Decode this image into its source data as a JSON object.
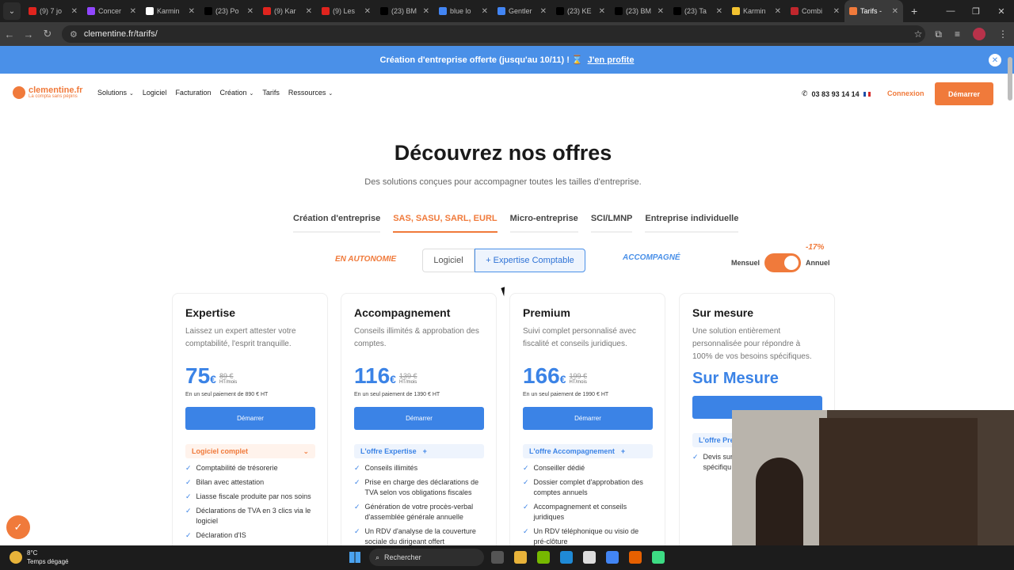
{
  "browser": {
    "tabs": [
      {
        "title": "(9) 7 jo",
        "color": "#e0241e"
      },
      {
        "title": "Concer",
        "color": "#9146ff"
      },
      {
        "title": "Karmin",
        "color": "#ffffff"
      },
      {
        "title": "(23) Po",
        "color": "#000000"
      },
      {
        "title": "(9) Kar",
        "color": "#e0241e"
      },
      {
        "title": "(9) Les",
        "color": "#e0241e"
      },
      {
        "title": "(23) BM",
        "color": "#000000"
      },
      {
        "title": "blue lo",
        "color": "#4285f4"
      },
      {
        "title": "Gentler",
        "color": "#4285f4"
      },
      {
        "title": "(23) KE",
        "color": "#000000"
      },
      {
        "title": "(23) BM",
        "color": "#000000"
      },
      {
        "title": "(23) Ta",
        "color": "#000000"
      },
      {
        "title": "Karmin",
        "color": "#f2c230"
      },
      {
        "title": "Combi",
        "color": "#c0272d"
      },
      {
        "title": "Tarifs -",
        "color": "#f07a3b"
      }
    ],
    "url": "clementine.fr/tarifs/"
  },
  "banner": {
    "text": "Création d'entreprise offerte (jusqu'au 10/11) ! ⌛",
    "link": "J'en profite"
  },
  "nav": {
    "logo": "clementine.fr",
    "logo_tagline": "La compta sans pépins",
    "items": [
      {
        "label": "Solutions",
        "caret": true
      },
      {
        "label": "Logiciel",
        "caret": false
      },
      {
        "label": "Facturation",
        "caret": false
      },
      {
        "label": "Création",
        "caret": true
      },
      {
        "label": "Tarifs",
        "caret": false
      },
      {
        "label": "Ressources",
        "caret": true
      }
    ],
    "phone": "03 83 93 14 14",
    "login": "Connexion",
    "cta": "Démarrer"
  },
  "hero": {
    "title": "Découvrez nos offres",
    "subtitle": "Des solutions conçues pour accompagner toutes les tailles d'entreprise."
  },
  "category_tabs": [
    {
      "label": "Création d'entreprise",
      "active": false
    },
    {
      "label": "SAS, SASU, SARL, EURL",
      "active": true
    },
    {
      "label": "Micro-entreprise",
      "active": false
    },
    {
      "label": "SCI/LMNP",
      "active": false
    },
    {
      "label": "Entreprise individuelle",
      "active": false
    }
  ],
  "mode_toggle": {
    "left_hint": "EN AUTONOMIE",
    "option_a": "Logiciel",
    "option_b": "+ Expertise Comptable",
    "right_hint": "ACCOMPAGNÉ"
  },
  "billing": {
    "monthly": "Mensuel",
    "yearly": "Annuel",
    "discount": "-17%"
  },
  "plans": [
    {
      "name": "Expertise",
      "desc": "Laissez un expert attester votre comptabilité, l'esprit tranquille.",
      "price": "75",
      "currency": "€",
      "old_price": "89 €",
      "unit": "HT/mois",
      "oneshot": "En un seul paiement de 890 € HT",
      "button": "Démarrer",
      "pill": "Logiciel complet",
      "pill_suffix": "⌄",
      "features": [
        "Comptabilité de trésorerie",
        "Bilan avec attestation",
        "Liasse fiscale produite par nos soins",
        "Déclarations de TVA en 3 clics via le logiciel",
        "Déclaration d'IS"
      ]
    },
    {
      "name": "Accompagnement",
      "desc": "Conseils illimités & approbation des comptes.",
      "price": "116",
      "currency": "€",
      "old_price": "139 €",
      "unit": "HT/mois",
      "oneshot": "En un seul paiement de 1390 € HT",
      "button": "Démarrer",
      "pill": "L'offre Expertise",
      "pill_suffix": "+",
      "features": [
        "Conseils illimités",
        "Prise en charge des déclarations de TVA selon vos obligations fiscales",
        "Génération de votre procès-verbal d'assemblée générale annuelle",
        "Un RDV d'analyse de la couverture sociale du dirigeant offert"
      ]
    },
    {
      "name": "Premium",
      "desc": "Suivi complet personnalisé avec fiscalité et conseils juridiques.",
      "price": "166",
      "currency": "€",
      "old_price": "199 €",
      "unit": "HT/mois",
      "oneshot": "En un seul paiement de 1990 € HT",
      "button": "Démarrer",
      "pill": "L'offre Accompagnement",
      "pill_suffix": "+",
      "features": [
        "Conseiller dédié",
        "Dossier complet d'approbation des comptes annuels",
        "Accompagnement et conseils juridiques",
        "Un RDV téléphonique ou visio de pré-clôture"
      ]
    },
    {
      "name": "Sur mesure",
      "desc": "Une solution entièrement personnalisée pour répondre à 100% de vos besoins spécifiques.",
      "big_label": "Sur Mesure",
      "pill": "L'offre Pre",
      "features": [
        "Devis sur sociétés d'affaires par exer spécifiqu"
      ]
    }
  ],
  "taskbar": {
    "temp": "8°C",
    "weather": "Temps dégagé",
    "search": "Rechercher"
  }
}
